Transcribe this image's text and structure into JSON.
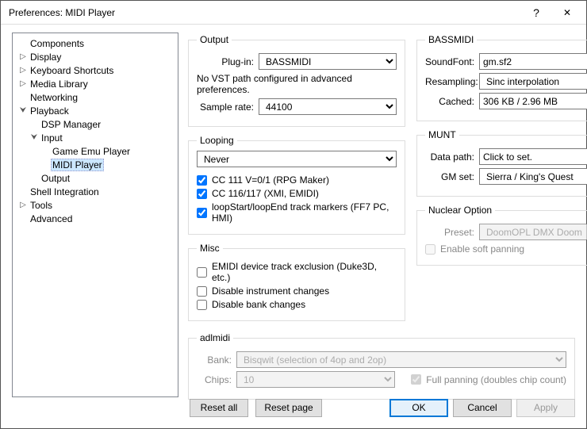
{
  "window": {
    "title": "Preferences: MIDI Player",
    "help": "?",
    "close": "✕"
  },
  "tree": {
    "components": "Components",
    "display": "Display",
    "keyboard": "Keyboard Shortcuts",
    "media": "Media Library",
    "networking": "Networking",
    "playback": "Playback",
    "dsp": "DSP Manager",
    "input": "Input",
    "gep": "Game Emu Player",
    "midi": "MIDI Player",
    "output_node": "Output",
    "shell": "Shell Integration",
    "tools": "Tools",
    "advanced": "Advanced"
  },
  "output": {
    "legend": "Output",
    "plugin_label": "Plug-in:",
    "plugin_value": "BASSMIDI",
    "note": "No VST path configured in advanced preferences.",
    "rate_label": "Sample rate:",
    "rate_value": "44100"
  },
  "looping": {
    "legend": "Looping",
    "mode": "Never",
    "cc111": "CC 111 V=0/1 (RPG Maker)",
    "cc116": "CC 116/117 (XMI, EMIDI)",
    "loopse": "loopStart/loopEnd track markers (FF7 PC, HMI)"
  },
  "misc": {
    "legend": "Misc",
    "emidi": "EMIDI device track exclusion (Duke3D, etc.)",
    "dinst": "Disable instrument changes",
    "dbank": "Disable bank changes"
  },
  "bassmidi": {
    "legend": "BASSMIDI",
    "sf_label": "SoundFont:",
    "sf_value": "gm.sf2",
    "res_label": "Resampling:",
    "res_value": "Sinc interpolation",
    "cache_label": "Cached:",
    "cache_value": "306 KB / 2.96 MB"
  },
  "munt": {
    "legend": "MUNT",
    "path_label": "Data path:",
    "path_value": "Click to set.",
    "gm_label": "GM set:",
    "gm_value": "Sierra / King's Quest"
  },
  "nuclear": {
    "legend": "Nuclear Option",
    "preset_label": "Preset:",
    "preset_value": "DoomOPL DMX Doom",
    "soft": "Enable soft panning"
  },
  "adlmidi": {
    "legend": "adlmidi",
    "bank_label": "Bank:",
    "bank_value": "Bisqwit (selection of 4op and 2op)",
    "chips_label": "Chips:",
    "chips_value": "10",
    "fullpan": "Full panning (doubles chip count)"
  },
  "footer": {
    "reset_all": "Reset all",
    "reset_page": "Reset page",
    "ok": "OK",
    "cancel": "Cancel",
    "apply": "Apply"
  }
}
